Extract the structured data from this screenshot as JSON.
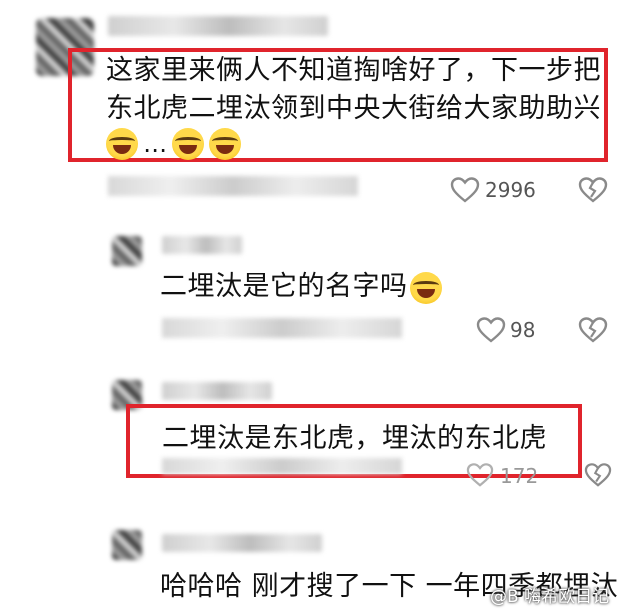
{
  "comments": [
    {
      "text_lines": [
        "这家里来俩人不知道掏啥好了，下一步把",
        "东北虎二埋汰领到中央大街给大家助助兴"
      ],
      "ellipsis": "…",
      "likes": "2996"
    },
    {
      "text": "二埋汰是它的名字吗",
      "likes": "98"
    },
    {
      "text": "二埋汰是东北虎，埋汰的东北虎",
      "likes": "172"
    },
    {
      "text": "哈哈哈 刚才搜了一下 一年四季都埋汰"
    }
  ],
  "watermark": "@B 嗨希欧日记",
  "colors": {
    "highlight_border": "#e0242c",
    "icon": "#8a8a8a"
  }
}
